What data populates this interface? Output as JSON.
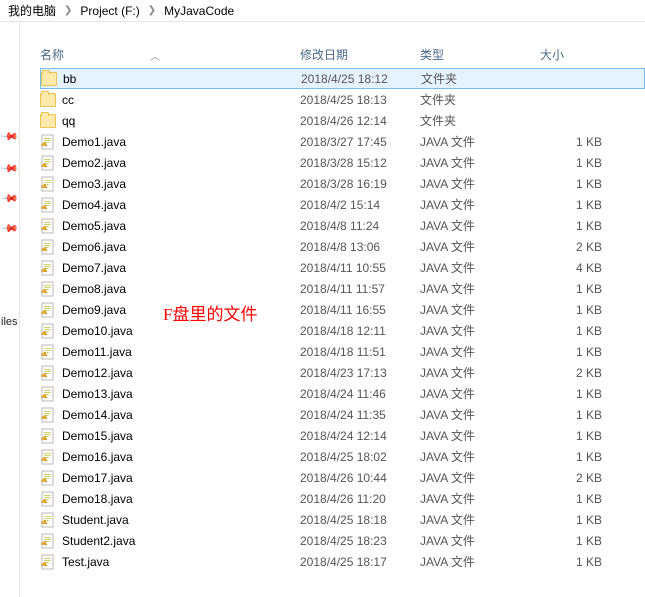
{
  "breadcrumb": {
    "part0": "我的电脑",
    "part1": "Project (F:)",
    "part2": "MyJavaCode"
  },
  "gutter": {
    "label": "iles"
  },
  "columns": {
    "name": "名称",
    "date": "修改日期",
    "type": "类型",
    "size": "大小"
  },
  "annotation": "F盘里的文件",
  "rows": [
    {
      "name": "bb",
      "date": "2018/4/25 18:12",
      "type": "文件夹",
      "size": "",
      "icon": "folder",
      "selected": true
    },
    {
      "name": "cc",
      "date": "2018/4/25 18:13",
      "type": "文件夹",
      "size": "",
      "icon": "folder"
    },
    {
      "name": "qq",
      "date": "2018/4/26 12:14",
      "type": "文件夹",
      "size": "",
      "icon": "folder"
    },
    {
      "name": "Demo1.java",
      "date": "2018/3/27 17:45",
      "type": "JAVA 文件",
      "size": "1 KB",
      "icon": "file"
    },
    {
      "name": "Demo2.java",
      "date": "2018/3/28 15:12",
      "type": "JAVA 文件",
      "size": "1 KB",
      "icon": "file"
    },
    {
      "name": "Demo3.java",
      "date": "2018/3/28 16:19",
      "type": "JAVA 文件",
      "size": "1 KB",
      "icon": "file"
    },
    {
      "name": "Demo4.java",
      "date": "2018/4/2 15:14",
      "type": "JAVA 文件",
      "size": "1 KB",
      "icon": "file"
    },
    {
      "name": "Demo5.java",
      "date": "2018/4/8 11:24",
      "type": "JAVA 文件",
      "size": "1 KB",
      "icon": "file"
    },
    {
      "name": "Demo6.java",
      "date": "2018/4/8 13:06",
      "type": "JAVA 文件",
      "size": "2 KB",
      "icon": "file"
    },
    {
      "name": "Demo7.java",
      "date": "2018/4/11 10:55",
      "type": "JAVA 文件",
      "size": "4 KB",
      "icon": "file"
    },
    {
      "name": "Demo8.java",
      "date": "2018/4/11 11:57",
      "type": "JAVA 文件",
      "size": "1 KB",
      "icon": "file"
    },
    {
      "name": "Demo9.java",
      "date": "2018/4/11 16:55",
      "type": "JAVA 文件",
      "size": "1 KB",
      "icon": "file"
    },
    {
      "name": "Demo10.java",
      "date": "2018/4/18 12:11",
      "type": "JAVA 文件",
      "size": "1 KB",
      "icon": "file"
    },
    {
      "name": "Demo11.java",
      "date": "2018/4/18 11:51",
      "type": "JAVA 文件",
      "size": "1 KB",
      "icon": "file"
    },
    {
      "name": "Demo12.java",
      "date": "2018/4/23 17:13",
      "type": "JAVA 文件",
      "size": "2 KB",
      "icon": "file"
    },
    {
      "name": "Demo13.java",
      "date": "2018/4/24 11:46",
      "type": "JAVA 文件",
      "size": "1 KB",
      "icon": "file"
    },
    {
      "name": "Demo14.java",
      "date": "2018/4/24 11:35",
      "type": "JAVA 文件",
      "size": "1 KB",
      "icon": "file"
    },
    {
      "name": "Demo15.java",
      "date": "2018/4/24 12:14",
      "type": "JAVA 文件",
      "size": "1 KB",
      "icon": "file"
    },
    {
      "name": "Demo16.java",
      "date": "2018/4/25 18:02",
      "type": "JAVA 文件",
      "size": "1 KB",
      "icon": "file"
    },
    {
      "name": "Demo17.java",
      "date": "2018/4/26 10:44",
      "type": "JAVA 文件",
      "size": "2 KB",
      "icon": "file"
    },
    {
      "name": "Demo18.java",
      "date": "2018/4/26 11:20",
      "type": "JAVA 文件",
      "size": "1 KB",
      "icon": "file"
    },
    {
      "name": "Student.java",
      "date": "2018/4/25 18:18",
      "type": "JAVA 文件",
      "size": "1 KB",
      "icon": "file"
    },
    {
      "name": "Student2.java",
      "date": "2018/4/25 18:23",
      "type": "JAVA 文件",
      "size": "1 KB",
      "icon": "file"
    },
    {
      "name": "Test.java",
      "date": "2018/4/25 18:17",
      "type": "JAVA 文件",
      "size": "1 KB",
      "icon": "file"
    }
  ]
}
